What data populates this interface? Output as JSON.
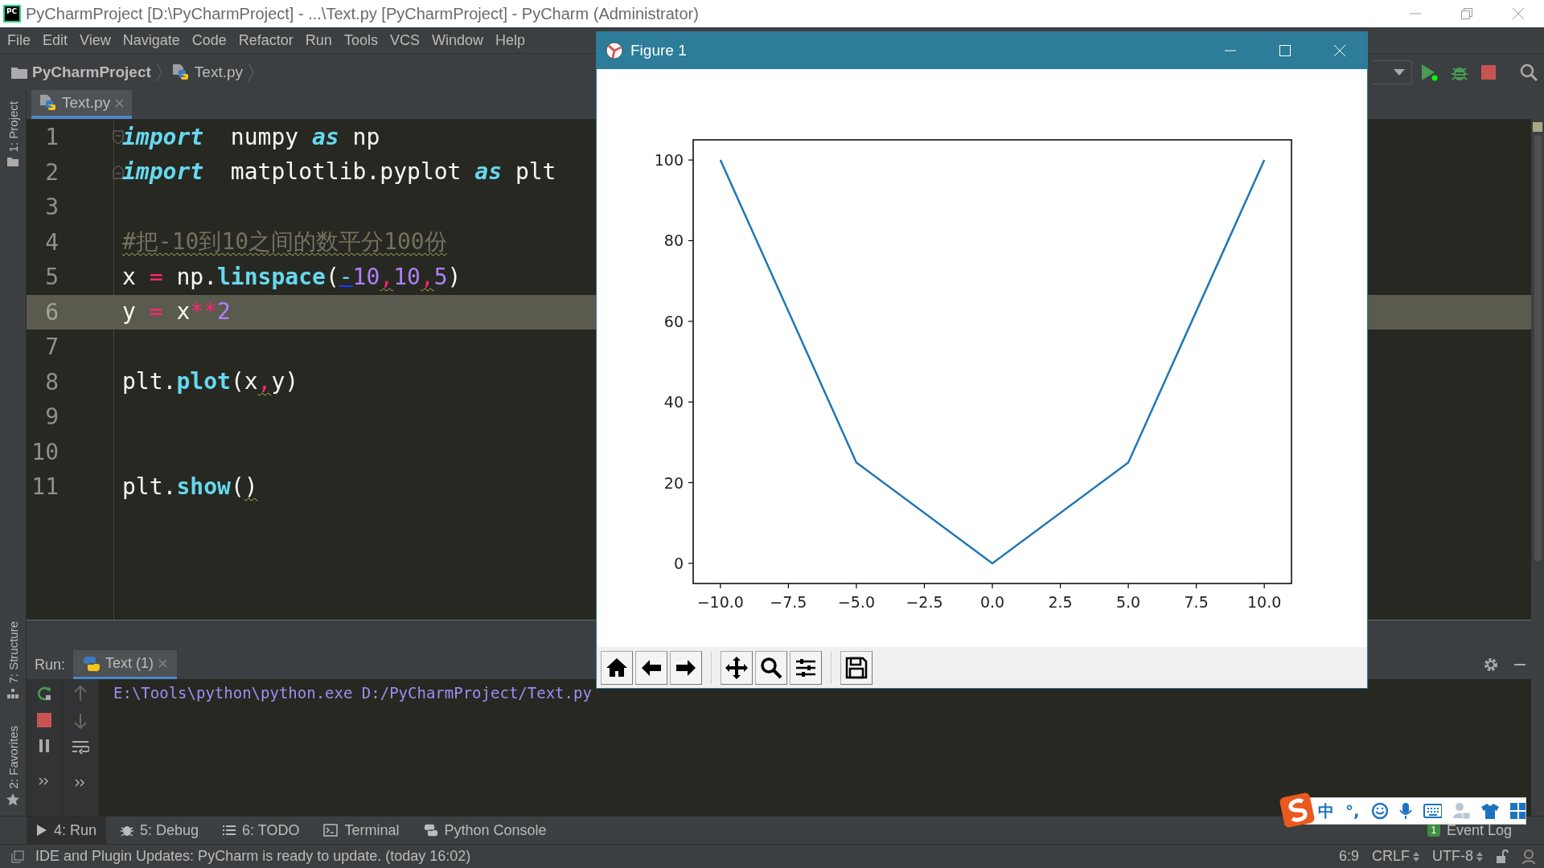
{
  "window": {
    "app_logo": "PC",
    "title": "PyCharmProject [D:\\PyCharmProject] - ...\\Text.py [PyCharmProject] - PyCharm (Administrator)"
  },
  "menu": [
    "File",
    "Edit",
    "View",
    "Navigate",
    "Code",
    "Refactor",
    "Run",
    "Tools",
    "VCS",
    "Window",
    "Help"
  ],
  "breadcrumb": [
    {
      "label": "PyCharmProject",
      "kind": "folder"
    },
    {
      "label": "Text.py",
      "kind": "file"
    }
  ],
  "left_tools": [
    {
      "label": "1: Project",
      "kind": "project"
    },
    {
      "label": "7: Structure",
      "kind": "structure"
    },
    {
      "label": "2: Favorites",
      "kind": "favorites"
    }
  ],
  "editor": {
    "tabs": [
      {
        "label": "Text.py",
        "selected": true
      }
    ],
    "lines": [
      {
        "number": "1",
        "kind": "fold-start",
        "current": false,
        "tokens": [
          {
            "t": "import",
            "kind": "keyword",
            "warn": false
          },
          {
            "t": "  numpy ",
            "kind": "plain",
            "warn": false
          },
          {
            "t": "as",
            "kind": "keyword",
            "warn": false
          },
          {
            "t": " np",
            "kind": "plain",
            "warn": false
          }
        ]
      },
      {
        "number": "2",
        "kind": "fold-end",
        "current": false,
        "tokens": [
          {
            "t": "import",
            "kind": "keyword",
            "warn": false
          },
          {
            "t": "  matplotlib.pyplot ",
            "kind": "plain",
            "warn": false
          },
          {
            "t": "as",
            "kind": "keyword",
            "warn": false
          },
          {
            "t": " plt",
            "kind": "plain",
            "warn": false
          }
        ]
      },
      {
        "number": "3",
        "kind": "plain",
        "current": false
      },
      {
        "number": "4",
        "kind": "plain",
        "current": false,
        "tokens": [
          {
            "t": "#把-10到10之间的数平分100份",
            "kind": "comment",
            "warn": true
          }
        ]
      },
      {
        "number": "5",
        "kind": "plain",
        "current": false,
        "tokens": [
          {
            "t": "x ",
            "kind": "plain",
            "warn": false
          },
          {
            "t": "=",
            "kind": "operator",
            "warn": false
          },
          {
            "t": " np.",
            "kind": "plain",
            "warn": false
          },
          {
            "t": "linspace",
            "kind": "function",
            "warn": false
          },
          {
            "t": "(",
            "kind": "plain",
            "warn": false
          },
          {
            "t": "-",
            "kind": "negative",
            "warn": false
          },
          {
            "t": "10",
            "kind": "number",
            "warn": false
          },
          {
            "t": ",",
            "kind": "operator",
            "warn": true
          },
          {
            "t": "10",
            "kind": "number",
            "warn": false
          },
          {
            "t": ",",
            "kind": "operator",
            "warn": true
          },
          {
            "t": "5",
            "kind": "number",
            "warn": false
          },
          {
            "t": ")",
            "kind": "plain",
            "warn": false
          }
        ]
      },
      {
        "number": "6",
        "kind": "plain",
        "current": true,
        "tokens": [
          {
            "t": "y ",
            "kind": "plain",
            "warn": false
          },
          {
            "t": "=",
            "kind": "operator",
            "warn": false
          },
          {
            "t": " x",
            "kind": "plain",
            "warn": false
          },
          {
            "t": "**",
            "kind": "operator",
            "warn": false
          },
          {
            "t": "2",
            "kind": "number",
            "warn": false
          }
        ]
      },
      {
        "number": "7",
        "kind": "plain",
        "current": false
      },
      {
        "number": "8",
        "kind": "plain",
        "current": false,
        "tokens": [
          {
            "t": "plt.",
            "kind": "plain",
            "warn": false
          },
          {
            "t": "plot",
            "kind": "function",
            "warn": false
          },
          {
            "t": "(",
            "kind": "plain",
            "warn": false
          },
          {
            "t": "x",
            "kind": "plain",
            "warn": false
          },
          {
            "t": ",",
            "kind": "operator",
            "warn": true
          },
          {
            "t": "y",
            "kind": "plain",
            "warn": false
          },
          {
            "t": ")",
            "kind": "plain",
            "warn": false
          }
        ]
      },
      {
        "number": "9",
        "kind": "plain",
        "current": false
      },
      {
        "number": "10",
        "kind": "plain",
        "current": false
      },
      {
        "number": "11",
        "kind": "plain",
        "current": false,
        "tokens": [
          {
            "t": "plt.",
            "kind": "plain",
            "warn": false
          },
          {
            "t": "show",
            "kind": "function",
            "warn": false
          },
          {
            "t": "(",
            "kind": "plain",
            "warn": false
          },
          {
            "t": ")",
            "kind": "plain",
            "warn": true
          }
        ]
      }
    ]
  },
  "run": {
    "label": "Run:",
    "tabs": [
      {
        "label": "Text (1)",
        "selected": true
      }
    ],
    "console": [
      "E:\\Tools\\python\\python.exe D:/PyCharmProject/Text.py"
    ]
  },
  "tool_tabs": [
    {
      "label": "4: Run",
      "kind": "run",
      "selected": true
    },
    {
      "label": "5: Debug",
      "kind": "debug",
      "selected": false
    },
    {
      "label": "6: TODO",
      "kind": "todo",
      "selected": false
    },
    {
      "label": "Terminal",
      "kind": "terminal",
      "selected": false
    },
    {
      "label": "Python Console",
      "kind": "console",
      "selected": false
    }
  ],
  "event_log": {
    "badge": "1",
    "label": "Event Log"
  },
  "status_bar": {
    "message": "IDE and Plugin Updates: PyCharm is ready to update. (today 16:02)",
    "position": "6:9",
    "line_separator": "CRLF",
    "encoding": "UTF-8"
  },
  "figure": {
    "title": "Figure 1",
    "chart_data": {
      "type": "line",
      "x": [
        -10,
        -5,
        0,
        5,
        10
      ],
      "series": [
        {
          "color": "#1f77b4",
          "values": [
            100,
            25,
            0,
            25,
            100
          ]
        }
      ],
      "xlim": [
        -11,
        11
      ],
      "ylim": [
        -5,
        105
      ],
      "xticks": [
        {
          "value": -10,
          "label": "−10.0"
        },
        {
          "value": -7.5,
          "label": "−7.5"
        },
        {
          "value": -5,
          "label": "−5.0"
        },
        {
          "value": -2.5,
          "label": "−2.5"
        },
        {
          "value": 0,
          "label": "0.0"
        },
        {
          "value": 2.5,
          "label": "2.5"
        },
        {
          "value": 5,
          "label": "5.0"
        },
        {
          "value": 7.5,
          "label": "7.5"
        },
        {
          "value": 10,
          "label": "10.0"
        }
      ],
      "yticks": [
        0,
        20,
        40,
        60,
        80,
        100
      ]
    }
  },
  "ime": {
    "items": [
      "中",
      "°,"
    ]
  }
}
